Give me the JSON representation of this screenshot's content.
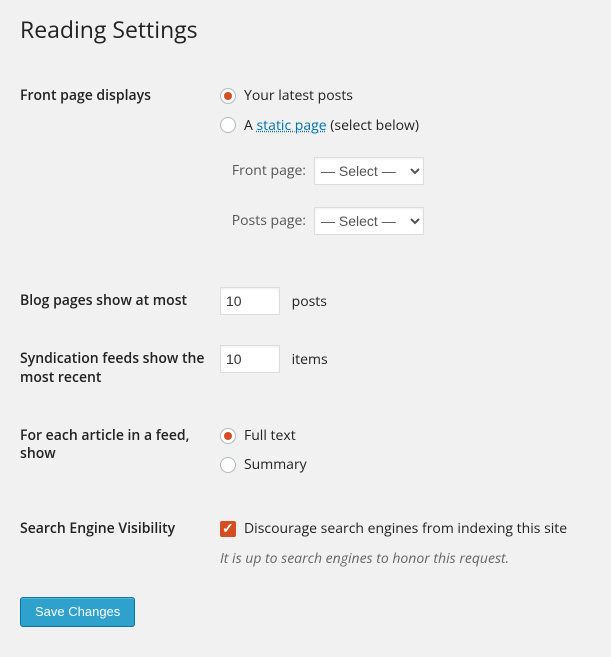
{
  "page_title": "Reading Settings",
  "front_page": {
    "label": "Front page displays",
    "option_latest": "Your latest posts",
    "option_static_prefix": "A ",
    "option_static_link": "static page",
    "option_static_suffix": " (select below)",
    "selected": "latest",
    "front_page_label": "Front page:",
    "posts_page_label": "Posts page:",
    "select_placeholder": "— Select —"
  },
  "blog_pages": {
    "label": "Blog pages show at most",
    "value": "10",
    "suffix": "posts"
  },
  "syndication": {
    "label": "Syndication feeds show the most recent",
    "value": "10",
    "suffix": "items"
  },
  "feed_article": {
    "label": "For each article in a feed, show",
    "option_full": "Full text",
    "option_summary": "Summary",
    "selected": "full"
  },
  "search_visibility": {
    "label": "Search Engine Visibility",
    "checkbox_label": "Discourage search engines from indexing this site",
    "checked": true,
    "description": "It is up to search engines to honor this request."
  },
  "submit_label": "Save Changes"
}
